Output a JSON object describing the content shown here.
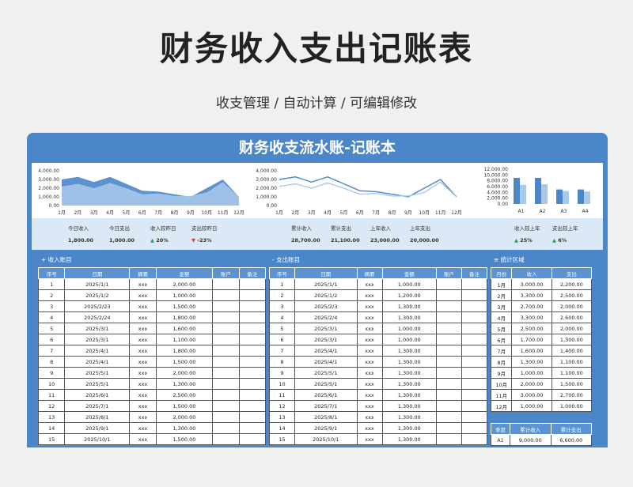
{
  "title": "财务收入支出记账表",
  "subtitle": "收支管理 / 自动计算 / 可编辑修改",
  "sheet_title": "财务收支流水账-记账本",
  "months": [
    "1月",
    "2月",
    "3月",
    "4月",
    "5月",
    "6月",
    "7月",
    "8月",
    "9月",
    "10月",
    "11月",
    "12月"
  ],
  "chart1_y": [
    "4,000.00",
    "3,000.00",
    "2,000.00",
    "1,000.00",
    "0.00"
  ],
  "chart2_y": [
    "4,000.00",
    "3,000.00",
    "2,000.00",
    "1,000.00",
    "0.00"
  ],
  "chart3_y": [
    "12,000.00",
    "10,000.00",
    "8,000.00",
    "6,000.00",
    "4,000.00",
    "2,000.00",
    "0.00"
  ],
  "quarters": [
    "A1",
    "A2",
    "A3",
    "A4"
  ],
  "chart_data": [
    {
      "type": "area",
      "categories": [
        "1月",
        "2月",
        "3月",
        "4月",
        "5月",
        "6月",
        "7月",
        "8月",
        "9月",
        "10月",
        "11月",
        "12月"
      ],
      "series": [
        {
          "values": [
            3000,
            3300,
            2700,
            3300,
            2500,
            1700,
            1600,
            1300,
            1000,
            2000,
            3000,
            1000
          ]
        },
        {
          "values": [
            2200,
            2500,
            2000,
            2600,
            2000,
            1300,
            1400,
            1100,
            1100,
            1500,
            2700,
            1000
          ]
        }
      ],
      "ylim": [
        0,
        4000
      ]
    },
    {
      "type": "line",
      "categories": [
        "1月",
        "2月",
        "3月",
        "4月",
        "5月",
        "6月",
        "7月",
        "8月",
        "9月",
        "10月",
        "11月",
        "12月"
      ],
      "series": [
        {
          "values": [
            3000,
            3300,
            2700,
            3300,
            2500,
            1700,
            1600,
            1300,
            1000,
            2000,
            3000,
            1000
          ]
        },
        {
          "values": [
            2200,
            2500,
            2000,
            2600,
            2000,
            1300,
            1400,
            1100,
            1100,
            1500,
            2700,
            1000
          ]
        }
      ],
      "ylim": [
        0,
        4000
      ]
    },
    {
      "type": "bar",
      "categories": [
        "A1",
        "A2",
        "A3",
        "A4"
      ],
      "series": [
        {
          "values": [
            9000,
            9000,
            5000,
            5000
          ]
        },
        {
          "values": [
            6600,
            6800,
            4500,
            4300
          ]
        }
      ],
      "ylim": [
        0,
        12000
      ]
    }
  ],
  "stats_left": [
    {
      "label": "今日收入",
      "value": "1,800.00"
    },
    {
      "label": "今日支出",
      "value": "1,000.00"
    },
    {
      "label": "收入较昨日",
      "value": "20%",
      "dir": "up"
    },
    {
      "label": "支出较昨日",
      "value": "-23%",
      "dir": "down"
    }
  ],
  "stats_mid": [
    {
      "label": "累计收入",
      "value": "28,700.00"
    },
    {
      "label": "累计支出",
      "value": "21,100.00"
    },
    {
      "label": "上年收入",
      "value": "23,000.00"
    },
    {
      "label": "上年支出",
      "value": "20,000.00"
    }
  ],
  "stats_right": [
    {
      "label": "收入较上年",
      "value": "25%",
      "dir": "up"
    },
    {
      "label": "支出较上年",
      "value": "6%",
      "dir": "up"
    }
  ],
  "income_panel": "+ 收入账目",
  "expense_panel": "- 支出账目",
  "stat_panel": "≡ 统计区域",
  "ledger_headers": [
    "序号",
    "日期",
    "摘要",
    "金额",
    "账户",
    "备注"
  ],
  "income_rows": [
    [
      "1",
      "2025/1/1",
      "xxx",
      "2,000.00"
    ],
    [
      "2",
      "2025/1/2",
      "xxx",
      "1,000.00"
    ],
    [
      "3",
      "2025/2/23",
      "xxx",
      "1,500.00"
    ],
    [
      "4",
      "2025/2/24",
      "xxx",
      "1,800.00"
    ],
    [
      "5",
      "2025/3/1",
      "xxx",
      "1,600.00"
    ],
    [
      "6",
      "2025/3/1",
      "xxx",
      "1,100.00"
    ],
    [
      "7",
      "2025/4/1",
      "xxx",
      "1,800.00"
    ],
    [
      "8",
      "2025/4/1",
      "xxx",
      "1,500.00"
    ],
    [
      "9",
      "2025/5/1",
      "xxx",
      "2,000.00"
    ],
    [
      "10",
      "2025/5/1",
      "xxx",
      "1,300.00"
    ],
    [
      "11",
      "2025/6/1",
      "xxx",
      "2,500.00"
    ],
    [
      "12",
      "2025/7/1",
      "xxx",
      "1,500.00"
    ],
    [
      "13",
      "2025/8/1",
      "xxx",
      "2,000.00"
    ],
    [
      "14",
      "2025/9/1",
      "xxx",
      "1,300.00"
    ],
    [
      "15",
      "2025/10/1",
      "xxx",
      "1,500.00"
    ]
  ],
  "expense_rows": [
    [
      "1",
      "2025/1/1",
      "xxx",
      "1,000.00"
    ],
    [
      "2",
      "2025/1/2",
      "xxx",
      "1,200.00"
    ],
    [
      "3",
      "2025/2/3",
      "xxx",
      "1,300.00"
    ],
    [
      "4",
      "2025/2/4",
      "xxx",
      "1,300.00"
    ],
    [
      "5",
      "2025/3/1",
      "xxx",
      "1,000.00"
    ],
    [
      "6",
      "2025/3/1",
      "xxx",
      "1,000.00"
    ],
    [
      "7",
      "2025/4/1",
      "xxx",
      "1,300.00"
    ],
    [
      "8",
      "2025/4/1",
      "xxx",
      "1,300.00"
    ],
    [
      "9",
      "2025/5/1",
      "xxx",
      "1,300.00"
    ],
    [
      "10",
      "2025/5/1",
      "xxx",
      "1,300.00"
    ],
    [
      "11",
      "2025/6/1",
      "xxx",
      "1,300.00"
    ],
    [
      "12",
      "2025/7/1",
      "xxx",
      "1,300.00"
    ],
    [
      "13",
      "2025/8/1",
      "xxx",
      "1,300.00"
    ],
    [
      "14",
      "2025/9/1",
      "xxx",
      "1,300.00"
    ],
    [
      "15",
      "2025/10/1",
      "xxx",
      "1,300.00"
    ]
  ],
  "stat_headers": [
    "月份",
    "收入",
    "支出"
  ],
  "stat_rows": [
    [
      "1月",
      "3,000.00",
      "2,200.00"
    ],
    [
      "2月",
      "3,300.00",
      "2,500.00"
    ],
    [
      "3月",
      "2,700.00",
      "2,000.00"
    ],
    [
      "4月",
      "3,300.00",
      "2,600.00"
    ],
    [
      "5月",
      "2,500.00",
      "2,000.00"
    ],
    [
      "6月",
      "1,700.00",
      "1,300.00"
    ],
    [
      "7月",
      "1,600.00",
      "1,400.00"
    ],
    [
      "8月",
      "1,300.00",
      "1,100.00"
    ],
    [
      "9月",
      "1,000.00",
      "1,100.00"
    ],
    [
      "10月",
      "2,000.00",
      "1,500.00"
    ],
    [
      "11月",
      "3,000.00",
      "2,700.00"
    ],
    [
      "12月",
      "1,000.00",
      "1,000.00"
    ]
  ],
  "quarter_headers": [
    "季度",
    "累计收入",
    "累计支出"
  ],
  "quarter_rows": [
    [
      "A1",
      "9,000.00",
      "6,600.00"
    ]
  ],
  "colors": {
    "dark": "#4a86c8",
    "light": "#a9c9ec"
  }
}
